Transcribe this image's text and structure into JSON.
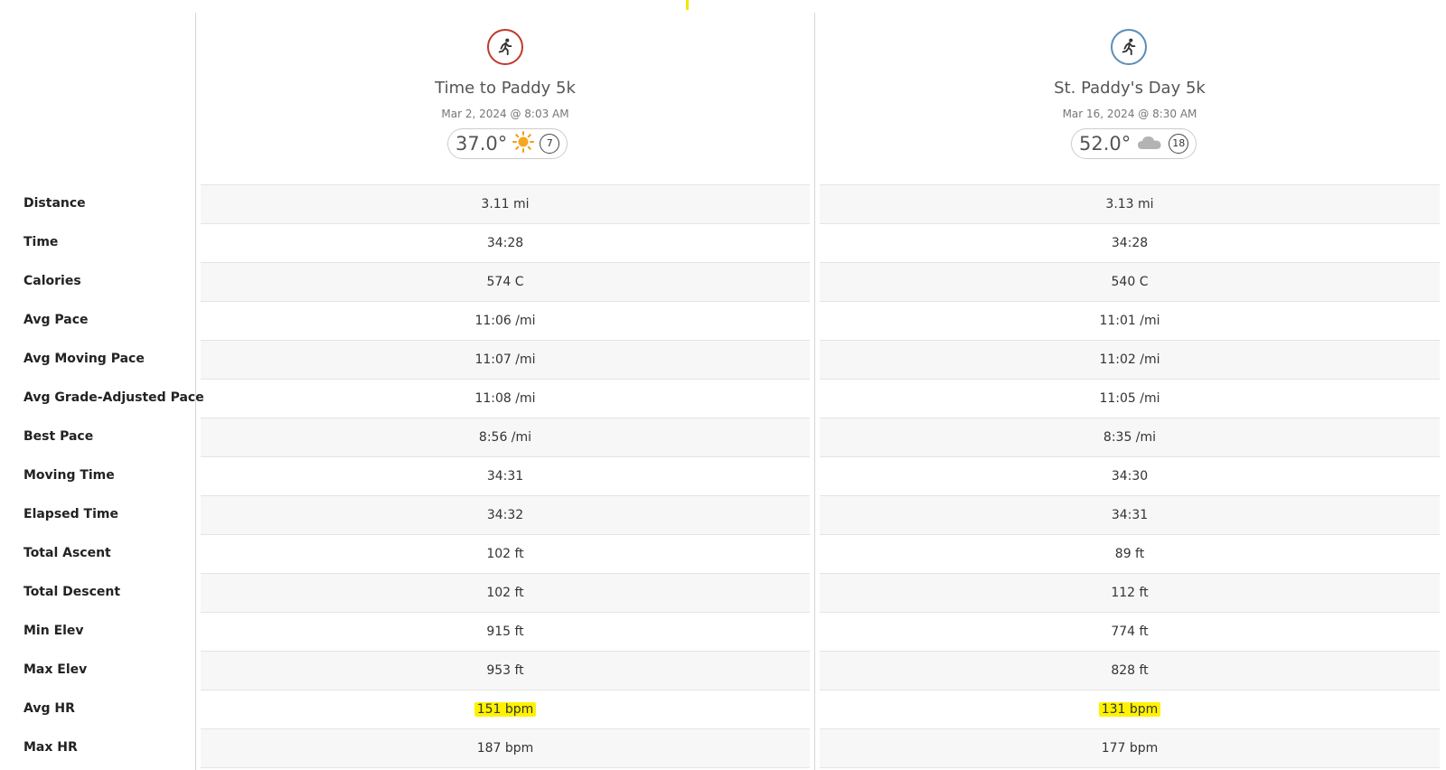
{
  "metrics": [
    "Distance",
    "Time",
    "Calories",
    "Avg Pace",
    "Avg Moving Pace",
    "Avg Grade-Adjusted Pace",
    "Best Pace",
    "Moving Time",
    "Elapsed Time",
    "Total Ascent",
    "Total Descent",
    "Min Elev",
    "Max Elev",
    "Avg HR",
    "Max HR"
  ],
  "activities": [
    {
      "title": "Time to Paddy 5k",
      "date": "Mar 2, 2024 @ 8:03 AM",
      "icon": "running-icon",
      "icon_color": "#c0392b",
      "temperature": "37.0°",
      "weather_icon": "sun-icon",
      "wind": "7",
      "values": [
        "3.11 mi",
        "34:28",
        "574 C",
        "11:06 /mi",
        "11:07 /mi",
        "11:08 /mi",
        "8:56 /mi",
        "34:31",
        "34:32",
        "102 ft",
        "102 ft",
        "915 ft",
        "953 ft",
        "151 bpm",
        "187 bpm"
      ],
      "highlighted_row": 13
    },
    {
      "title": "St. Paddy's Day 5k",
      "date": "Mar 16, 2024 @ 8:30 AM",
      "icon": "running-icon",
      "icon_color": "#5b8db8",
      "temperature": "52.0°",
      "weather_icon": "cloud-icon",
      "wind": "18",
      "values": [
        "3.13 mi",
        "34:28",
        "540 C",
        "11:01 /mi",
        "11:02 /mi",
        "11:05 /mi",
        "8:35 /mi",
        "34:30",
        "34:31",
        "89 ft",
        "112 ft",
        "774 ft",
        "828 ft",
        "131 bpm",
        "177 bpm"
      ],
      "highlighted_row": 13
    }
  ],
  "colors": {
    "highlight": "#fff200",
    "row_shade": "#f7f7f7",
    "border": "#e4e4e4"
  }
}
